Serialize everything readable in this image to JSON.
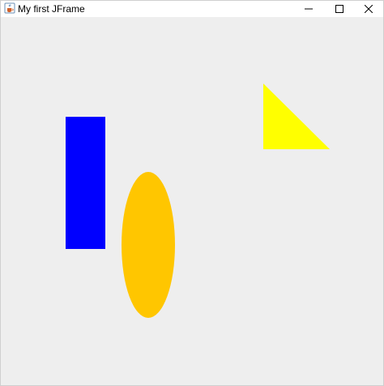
{
  "window": {
    "title": "My first JFrame",
    "app_icon": "java-cup-icon",
    "controls": [
      "minimize-icon",
      "maximize-icon",
      "close-icon"
    ]
  },
  "canvas": {
    "background": "#eeeeee",
    "shapes": [
      {
        "kind": "rectangle",
        "color": "#0000ff"
      },
      {
        "kind": "ellipse",
        "color": "#ffc600"
      },
      {
        "kind": "triangle",
        "color": "#ffff00"
      }
    ]
  }
}
